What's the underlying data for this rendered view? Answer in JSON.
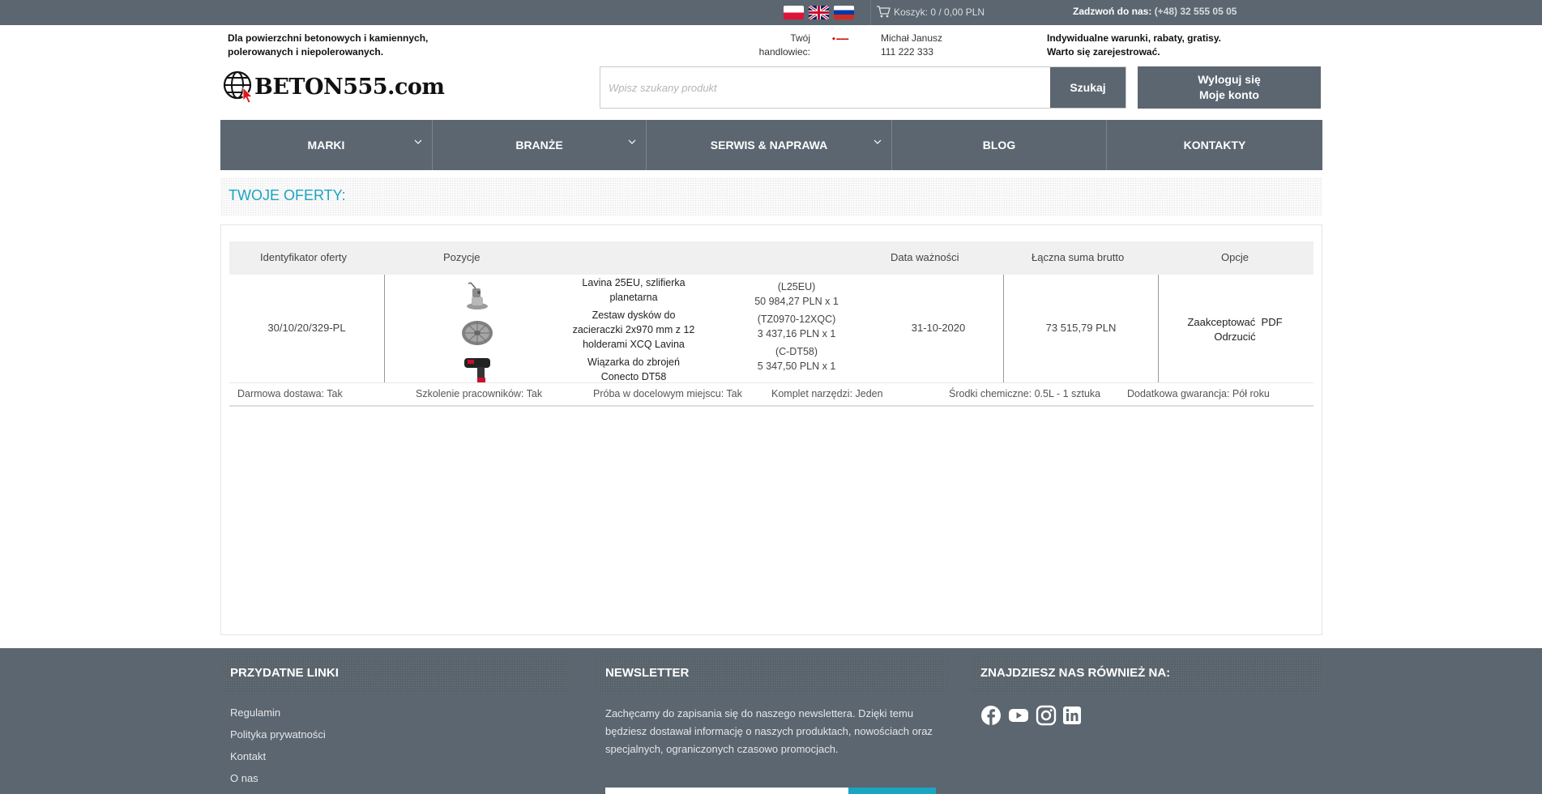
{
  "topbar": {
    "flags": [
      "pl",
      "gb",
      "ru"
    ],
    "cart_label": "Koszyk: 0 / 0,00 PLN",
    "phone_label": "Zadzwoń do nas:",
    "phone_number": "(+48) 32 555 05 05"
  },
  "header": {
    "tagline": "Dla powierzchni betonowych i kamiennych, polerowanych i niepolerowanych.",
    "logo_text": "BETON555.com",
    "rep_label": "Twój handlowiec:",
    "rep_name": "Michał Janusz",
    "rep_phone": "111 222 333",
    "promo_line1": "Indywidualne warunki, rabaty, gratisy.",
    "promo_line2": "Warto się zarejestrować.",
    "search_placeholder": "Wpisz szukany produkt",
    "search_button": "Szukaj",
    "logout_label": "Wyloguj się",
    "account_label": "Moje konto"
  },
  "nav": {
    "items": [
      {
        "label": "MARKI",
        "dropdown": true
      },
      {
        "label": "BRANŻE",
        "dropdown": true
      },
      {
        "label": "SERWIS & NAPRAWA",
        "dropdown": true
      },
      {
        "label": "BLOG",
        "dropdown": false
      },
      {
        "label": "KONTAKTY",
        "dropdown": false
      }
    ]
  },
  "offers": {
    "title": "TWOJE OFERTY:",
    "columns": [
      "Identyfikator oferty",
      "Pozycje",
      "Data ważności",
      "Łączna suma brutto",
      "Opcje"
    ],
    "rows": [
      {
        "id": "30/10/20/329-PL",
        "items": [
          {
            "name": "Lavina 25EU, szlifierka planetarna",
            "code": "(L25EU)",
            "price": "50 984,27 PLN x 1"
          },
          {
            "name": "Zestaw dysków do zacieraczki 2x970 mm z 12 holderami XCQ Lavina",
            "code": "(TZ0970-12XQC)",
            "price": "3 437,16 PLN x 1"
          },
          {
            "name": "Wiązarka do zbrojeń Conecto DT58",
            "code": "(C-DT58)",
            "price": "5 347,50 PLN x 1"
          }
        ],
        "valid_until": "31-10-2020",
        "total": "73 515,79 PLN",
        "opt_accept": "Zaakceptować",
        "opt_pdf": "PDF",
        "opt_reject": "Odrzucić"
      }
    ],
    "extras": [
      "Darmowa dostawa: Tak",
      "Szkolenie pracowników: Tak",
      "Próba w docelowym miejscu: Tak",
      "Komplet narzędzi: Jeden",
      "Środki chemiczne: 0.5L - 1 sztuka",
      "Dodatkowa gwarancja: Pół roku"
    ]
  },
  "footer": {
    "links_title": "PRZYDATNE LINKI",
    "links": [
      "Regulamin",
      "Polityka prywatności",
      "Kontakt",
      "O nas"
    ],
    "newsletter_title": "NEWSLETTER",
    "newsletter_text": "Zachęcamy do zapisania się do naszego newslettera. Dzięki temu będziesz dostawał informację o naszych produktach, nowościach oraz specjalnych, ograniczonych czasowo promocjach.",
    "social_title": "ZNAJDZIESZ NAS RÓWNIEŻ NA:",
    "social_icons": [
      "facebook-icon",
      "youtube-icon",
      "instagram-icon",
      "linkedin-icon"
    ]
  },
  "colors": {
    "bar": "#5c6670",
    "accent": "#1aa5c0"
  }
}
